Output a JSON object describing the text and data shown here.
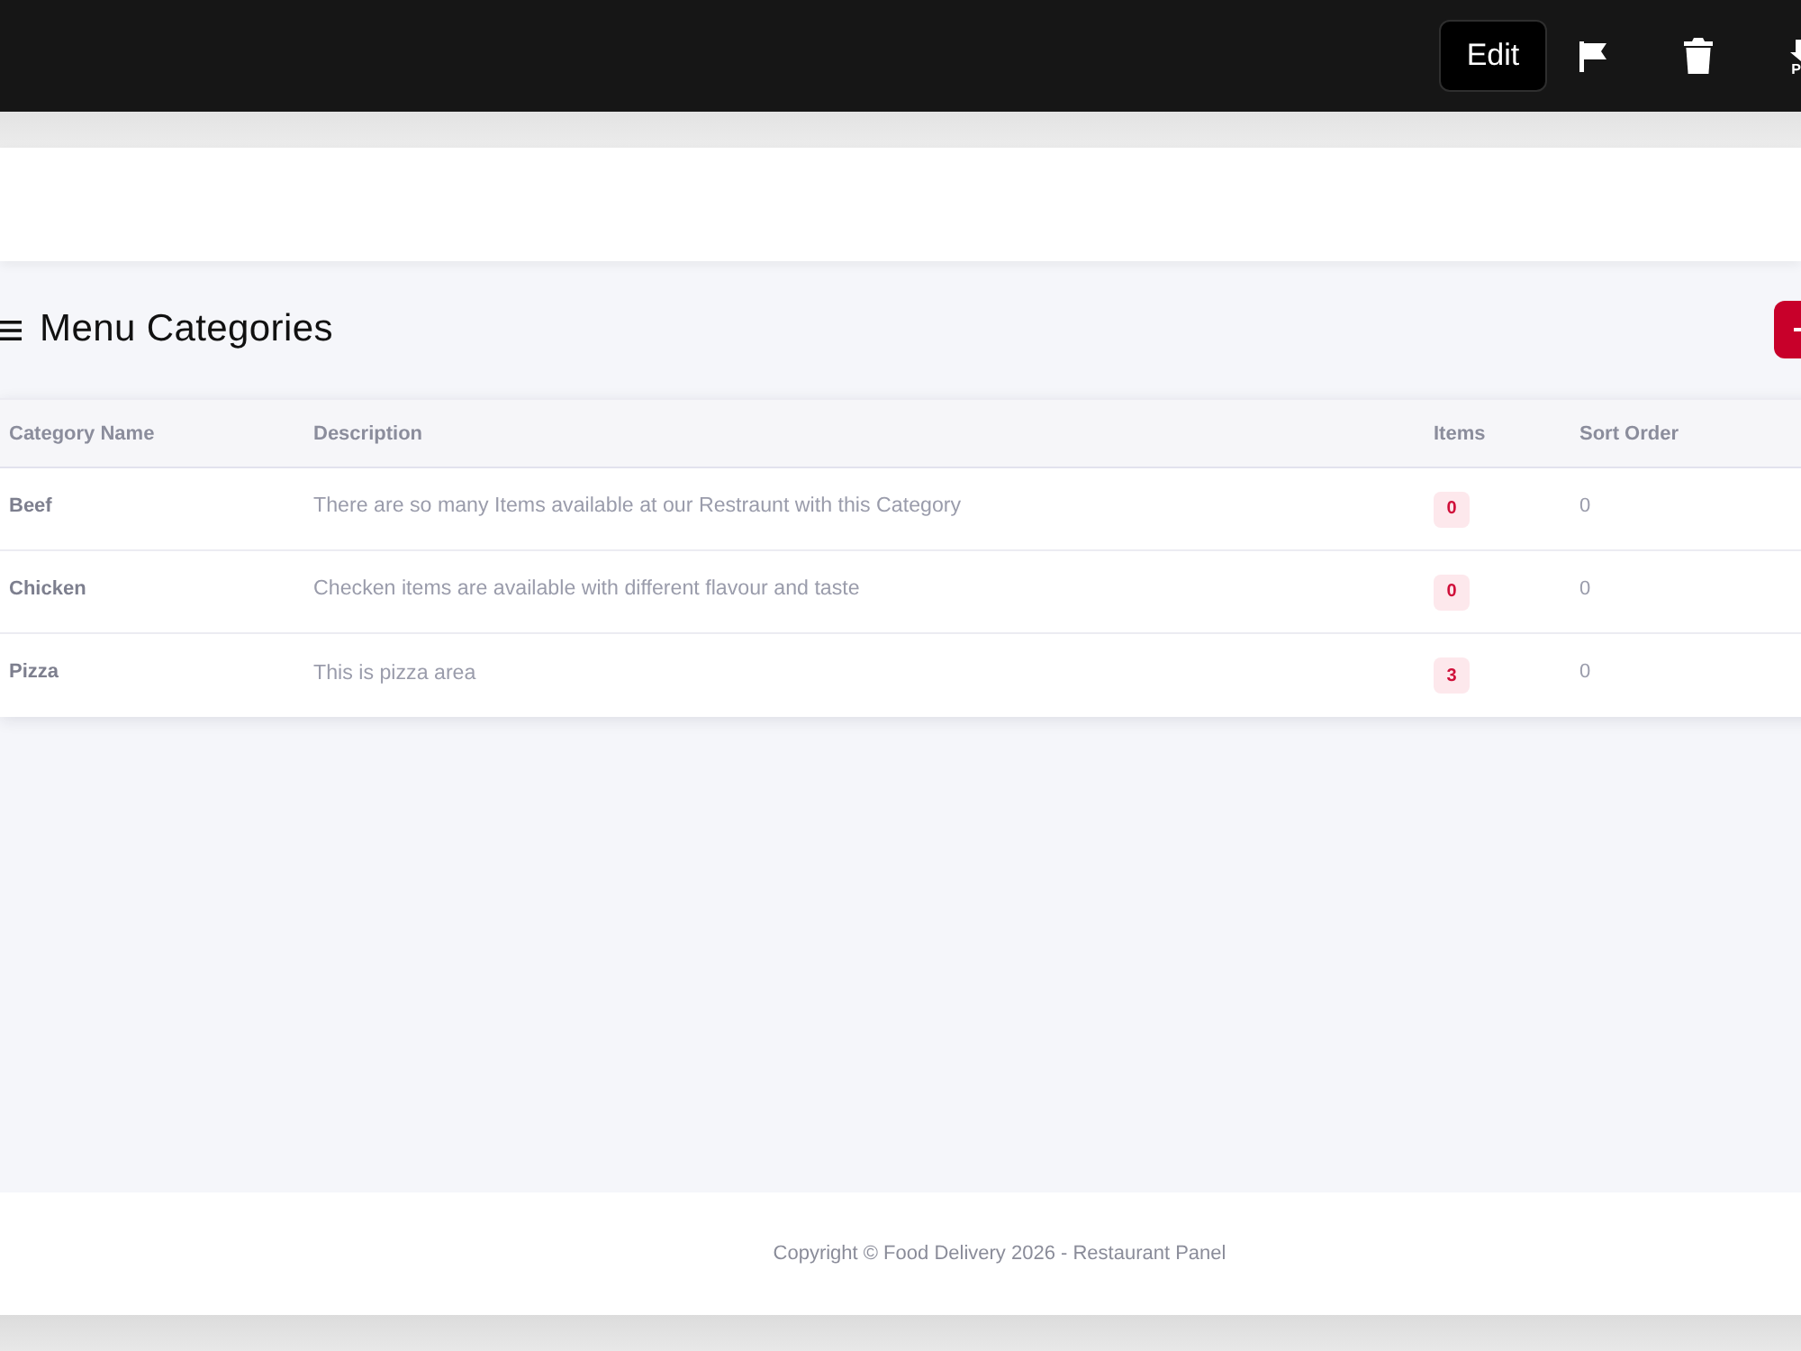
{
  "toolbar": {
    "edit_label": "Edit",
    "cut_label": "P"
  },
  "page": {
    "title": "Menu Categories"
  },
  "table": {
    "columns": [
      "Category Name",
      "Description",
      "Items",
      "Sort Order"
    ],
    "rows": [
      {
        "name": "Beef",
        "description": "There are so many Items available at our Restraunt with this Category",
        "items": "0",
        "sort_order": "0"
      },
      {
        "name": "Chicken",
        "description": "Checken items are available with different flavour and taste",
        "items": "0",
        "sort_order": "0"
      },
      {
        "name": "Pizza",
        "description": "This is pizza area",
        "items": "3",
        "sort_order": "0"
      }
    ]
  },
  "footer": {
    "text": "Copyright © Food Delivery 2026 - Restaurant Panel"
  }
}
